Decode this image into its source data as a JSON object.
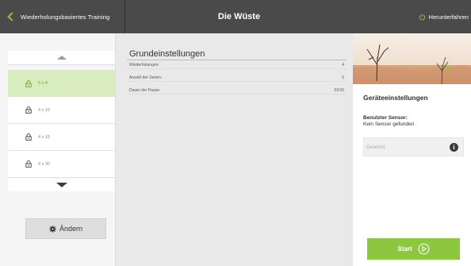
{
  "header": {
    "back_label": "Wiederholungsbasiertes Training",
    "title": "Die Wüste",
    "shutdown_label": "Herunterfahren"
  },
  "sidebar": {
    "items": [
      {
        "label": "5 x 4",
        "locked": true,
        "active": true
      },
      {
        "label": "4 x 10",
        "locked": true,
        "active": false
      },
      {
        "label": "4 x 15",
        "locked": true,
        "active": false
      },
      {
        "label": "4 x 30",
        "locked": true,
        "active": false
      }
    ],
    "change_label": "Ändern"
  },
  "settings": {
    "title": "Grundeinstellungen",
    "rows": [
      {
        "key": "Wiederholungen:",
        "value": "4"
      },
      {
        "key": "Anzahl der Serien:",
        "value": "5"
      },
      {
        "key": "Dauer der Pause:",
        "value": "03:00"
      }
    ]
  },
  "device": {
    "title": "Geräteeinstellungen",
    "sensor_label": "Benutzter Sensor:",
    "sensor_value": "Kein Sensor gefunden",
    "weight_placeholder": "Gewicht",
    "start_label": "Start"
  },
  "colors": {
    "accent": "#8dc63f",
    "topbar": "#4a4a4a",
    "active_item": "#d8ecbf"
  },
  "icons": [
    "chevron-left-icon",
    "power-icon",
    "lock-icon",
    "chevron-up-icon",
    "chevron-down-icon",
    "gear-icon",
    "info-icon",
    "play-icon"
  ]
}
